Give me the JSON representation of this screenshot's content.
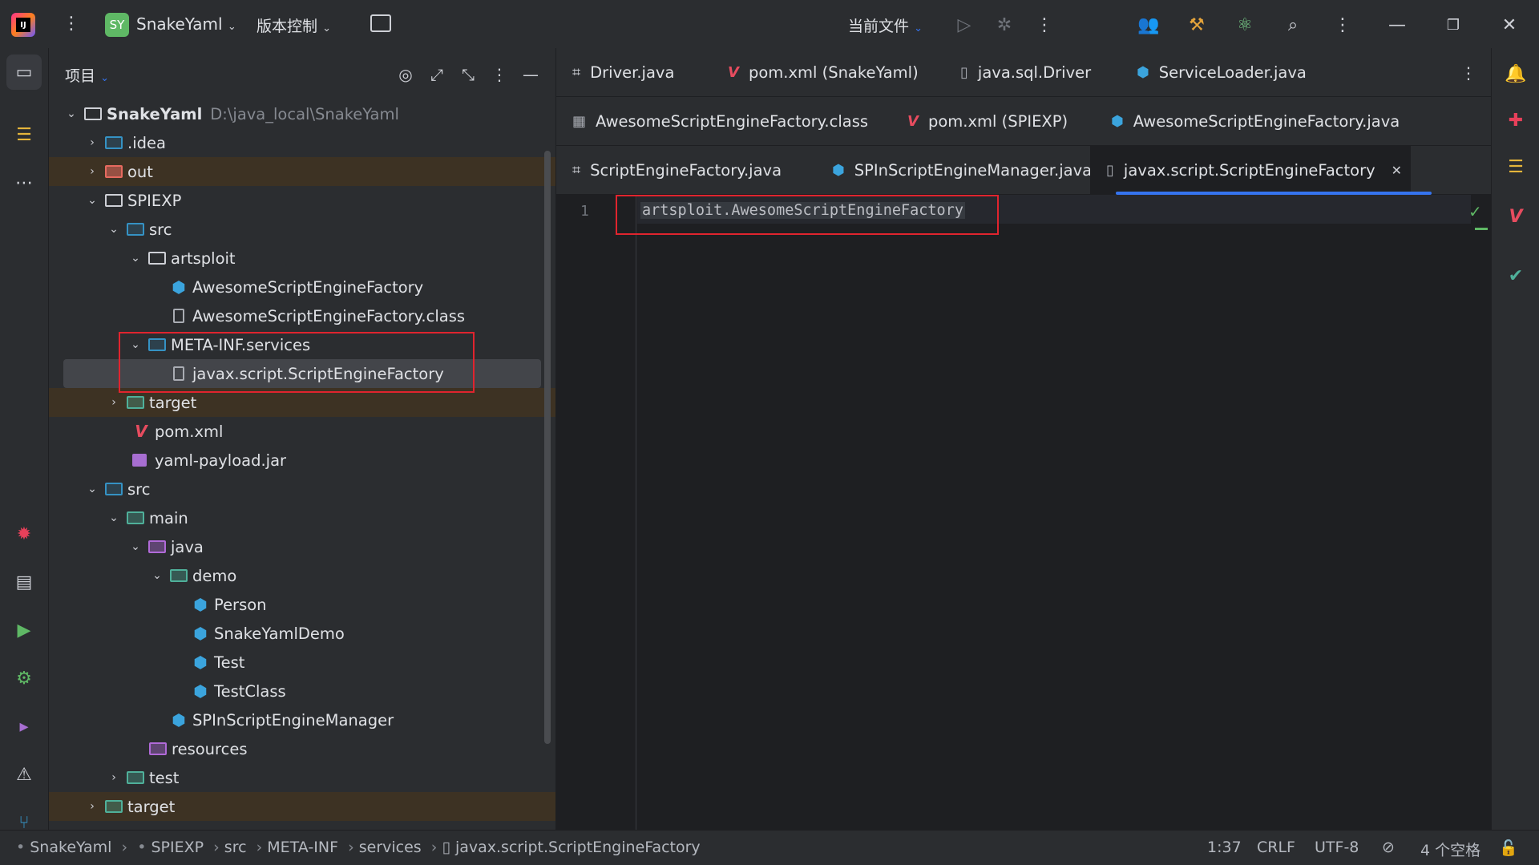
{
  "titlebar": {
    "logo_text": "IJ",
    "project_badge": "SY",
    "project_name": "SnakeYaml",
    "vcs_label": "版本控制",
    "run_config": "当前文件"
  },
  "left_toolbar": {
    "icons": [
      "project-icon",
      "structure-icon",
      "more-icon",
      "debug-icon",
      "services-icon",
      "run-icon",
      "settings-icon",
      "terminal-icon",
      "problems-icon",
      "git-icon"
    ]
  },
  "project_panel": {
    "title": "项目",
    "tree": [
      {
        "label": "SnakeYaml",
        "path": "D:\\java_local\\SnakeYaml"
      },
      {
        "label": ".idea"
      },
      {
        "label": "out"
      },
      {
        "label": "SPIEXP"
      },
      {
        "label": "src"
      },
      {
        "label": "artsploit"
      },
      {
        "label": "AwesomeScriptEngineFactory"
      },
      {
        "label": "AwesomeScriptEngineFactory.class"
      },
      {
        "label": "META-INF.services"
      },
      {
        "label": "javax.script.ScriptEngineFactory"
      },
      {
        "label": "target"
      },
      {
        "label": "pom.xml"
      },
      {
        "label": "yaml-payload.jar"
      },
      {
        "label": "src"
      },
      {
        "label": "main"
      },
      {
        "label": "java"
      },
      {
        "label": "demo"
      },
      {
        "label": "Person"
      },
      {
        "label": "SnakeYamlDemo"
      },
      {
        "label": "Test"
      },
      {
        "label": "TestClass"
      },
      {
        "label": "SPInScriptEngineManager"
      },
      {
        "label": "resources"
      },
      {
        "label": "test"
      },
      {
        "label": "target"
      }
    ]
  },
  "editor": {
    "tabs_row1": [
      "Driver.java",
      "pom.xml (SnakeYaml)",
      "java.sql.Driver",
      "ServiceLoader.java"
    ],
    "tabs_row2": [
      "AwesomeScriptEngineFactory.class",
      "pom.xml (SPIEXP)",
      "AwesomeScriptEngineFactory.java"
    ],
    "tabs_row3": [
      "ScriptEngineFactory.java",
      "SPInScriptEngineManager.java",
      "javax.script.ScriptEngineFactory"
    ],
    "active_tab": "javax.script.ScriptEngineFactory",
    "line_number": "1",
    "code_line": "artsploit.AwesomeScriptEngineFactory"
  },
  "statusbar": {
    "breadcrumbs": [
      "SnakeYaml",
      "SPIEXP",
      "src",
      "META-INF",
      "services",
      "javax.script.ScriptEngineFactory"
    ],
    "position": "1:37",
    "line_ending": "CRLF",
    "encoding": "UTF-8",
    "indent": "4 个空格"
  },
  "colors": {
    "accent": "#3574f0",
    "highlight_box": "#e0242e",
    "excluded_bg": "#3d3223"
  }
}
